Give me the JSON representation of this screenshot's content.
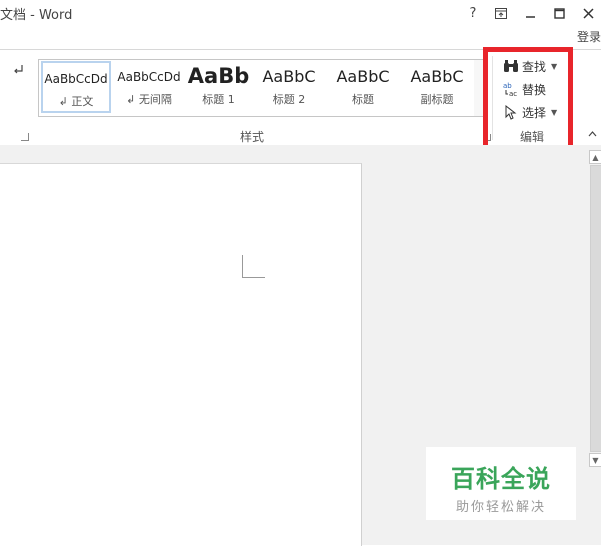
{
  "window": {
    "title": "文档 - Word",
    "help_label": "?",
    "minimize_label": "—",
    "maximize_label": "☐",
    "close_label": "✕",
    "ribbon_display_label": "⊡",
    "sign_in": "登录"
  },
  "ribbon": {
    "styles_group_label": "样式",
    "styles": [
      {
        "sample": "AaBbCcDd",
        "label": "↲ 正文",
        "selected": true
      },
      {
        "sample": "AaBbCcDd",
        "label": "↲ 无间隔",
        "selected": false
      },
      {
        "sample": "AaBb",
        "label": "标题 1",
        "selected": false
      },
      {
        "sample": "AaBbC",
        "label": "标题 2",
        "selected": false
      },
      {
        "sample": "AaBbC",
        "label": "标题",
        "selected": false
      },
      {
        "sample": "AaBbC",
        "label": "副标题",
        "selected": false
      }
    ],
    "editing": {
      "group_label": "编辑",
      "find_label": "查找",
      "replace_label": "替换",
      "select_label": "选择"
    },
    "icons": {
      "paragraph_mark": "paragraph-mark-icon",
      "find": "binoculars-icon",
      "replace": "replace-icon",
      "select": "cursor-icon"
    }
  },
  "watermark": {
    "title": "百科全说",
    "subtitle": "助你轻松解决"
  },
  "colors": {
    "highlight": "#e8252b",
    "watermark_green": "#3aa55a"
  }
}
